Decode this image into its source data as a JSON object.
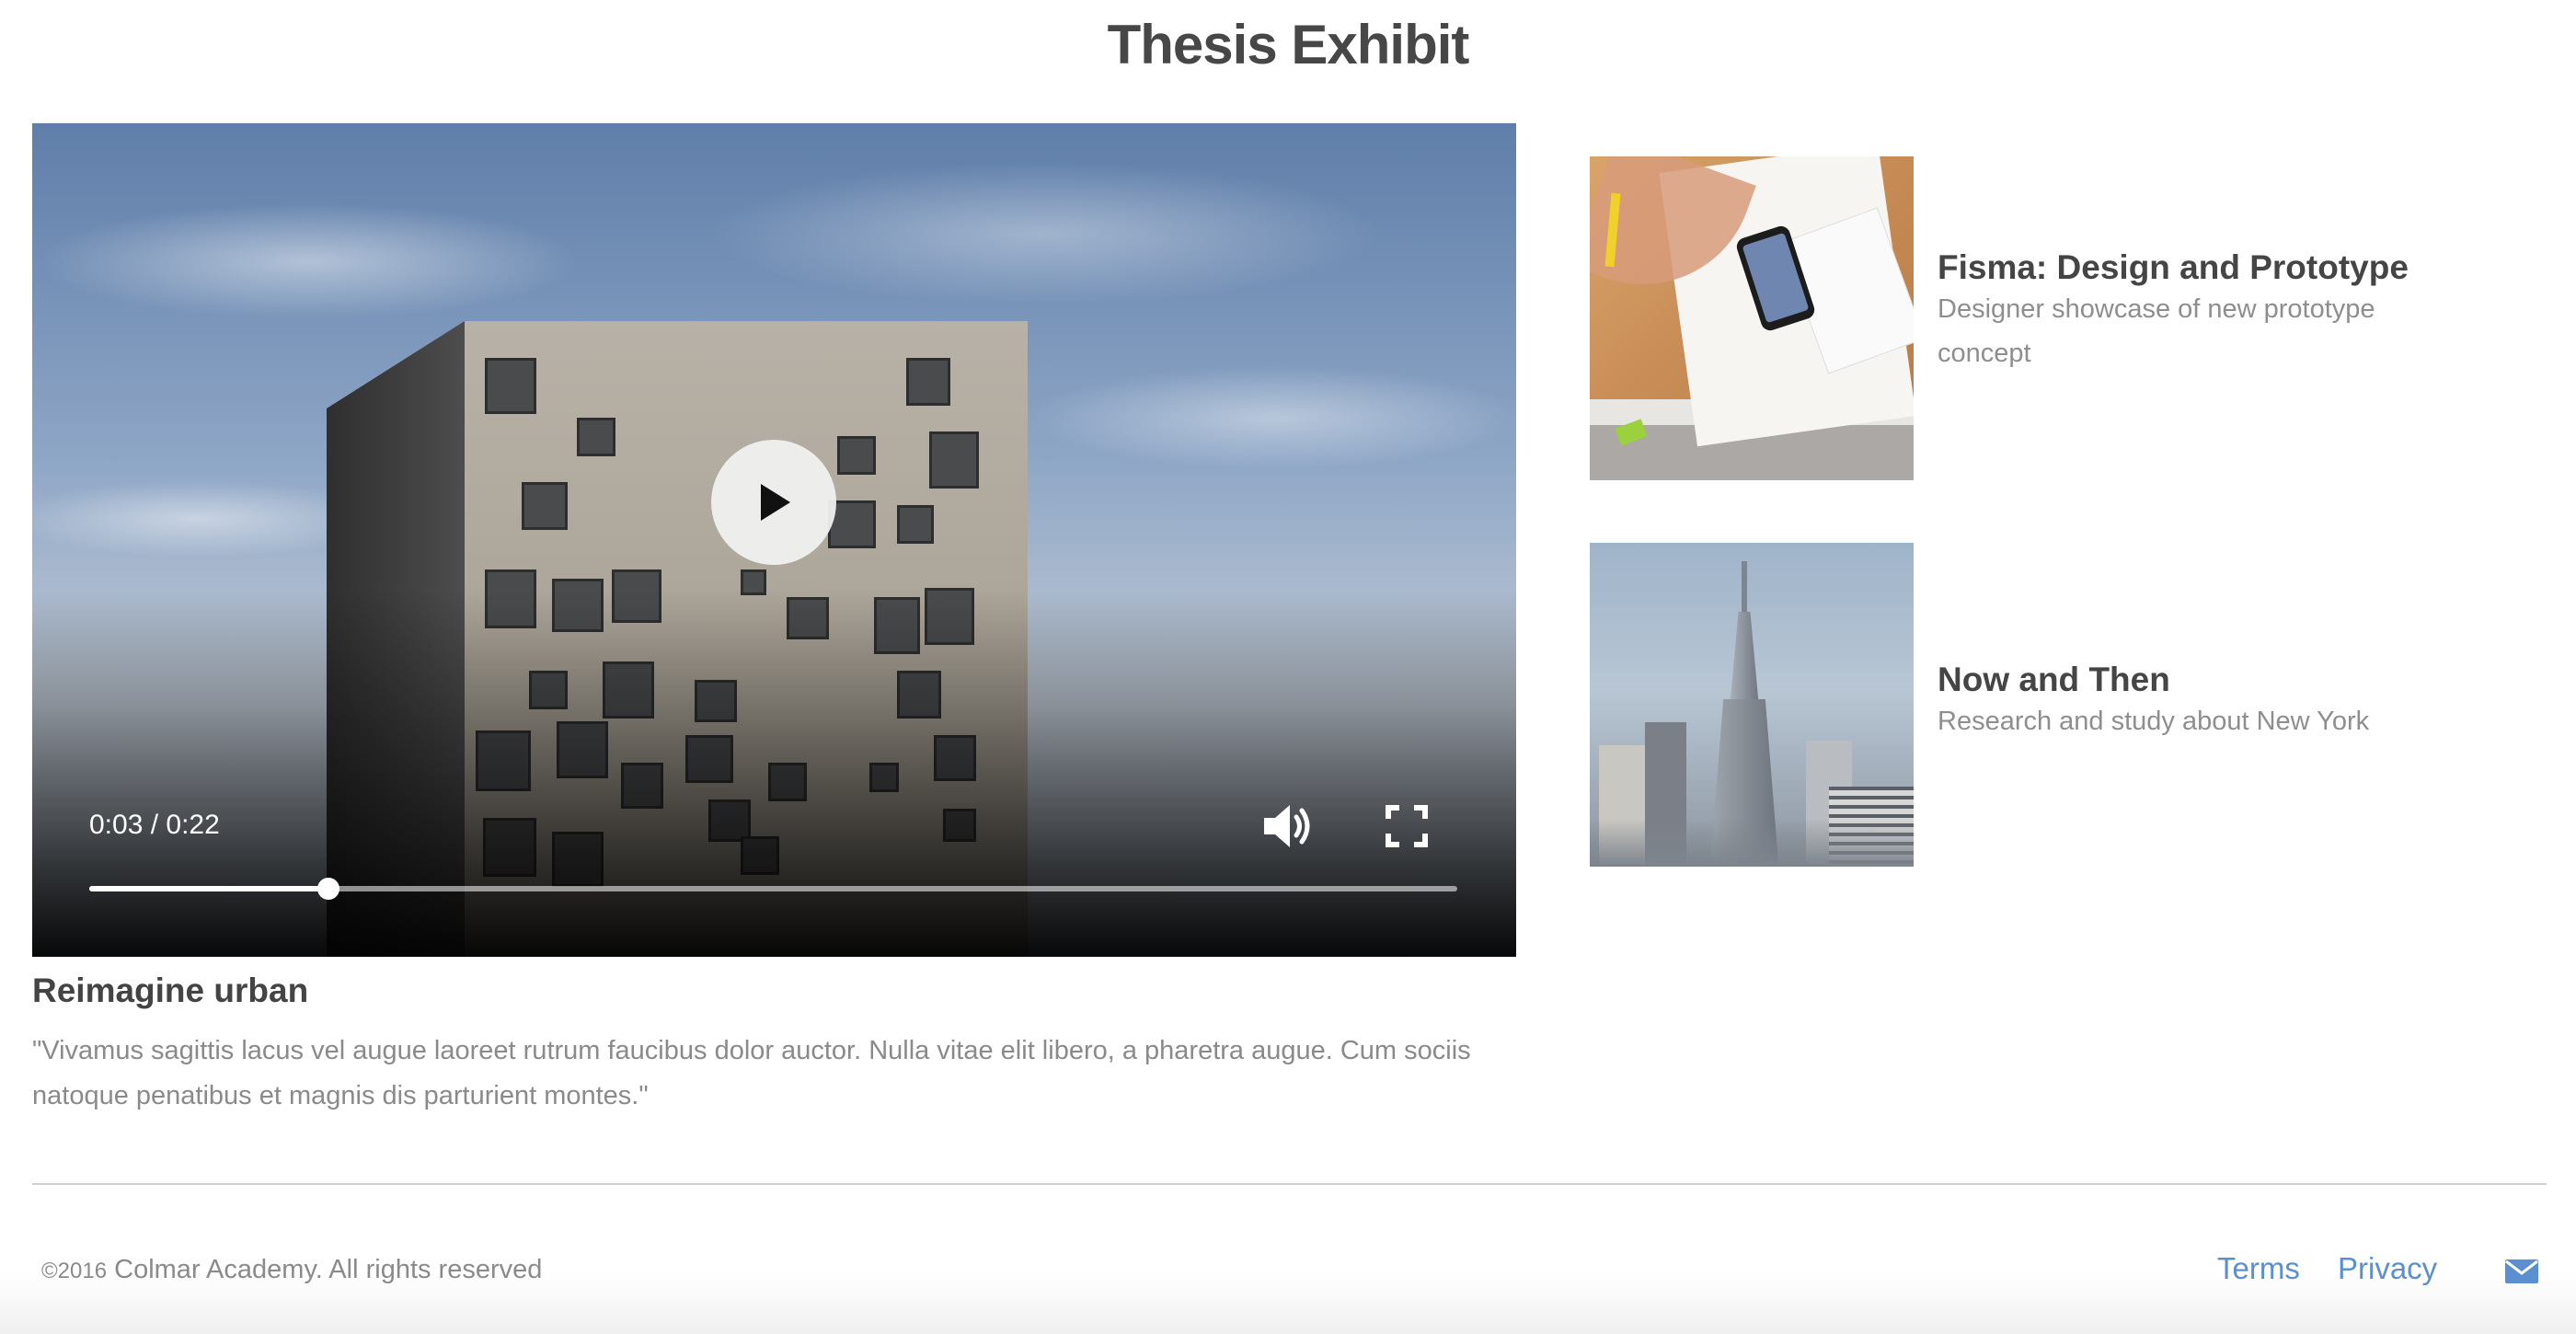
{
  "page": {
    "title": "Thesis Exhibit"
  },
  "video": {
    "title": "Reimagine urban",
    "description": "\"Vivamus sagittis lacus vel augue laoreet rutrum faucibus dolor auctor. Nulla vitae elit libero, a pharetra augue. Cum sociis natoque penatibus et magnis dis parturient montes.\"",
    "time": "0:03 / 0:22",
    "progress": 0.175,
    "icons": {
      "play": "play-icon",
      "volume": "volume-icon",
      "fullscreen": "fullscreen-icon"
    }
  },
  "side_items": [
    {
      "title": "Fisma: Design and Prototype",
      "description": "Designer showcase of new prototype concept"
    },
    {
      "title": "Now and Then",
      "description": "Research and study about New York"
    }
  ],
  "footer": {
    "copyright_symbol_year": "©2016",
    "copyright_text": "Colmar Academy. All rights reserved",
    "links": [
      "Terms",
      "Privacy"
    ],
    "icons": {
      "mail": "mail-icon"
    }
  },
  "colors": {
    "link": "#5b8fd0",
    "title": "#474747",
    "muted": "#8a8a8a"
  }
}
